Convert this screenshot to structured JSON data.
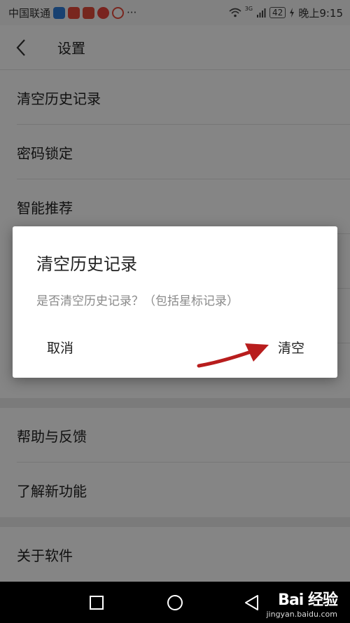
{
  "status_bar": {
    "carrier": "中国联通",
    "app_icon_colors": [
      "#2f7ed8",
      "#e84c3d",
      "#e84c3d",
      "#e8443c"
    ],
    "more": "···",
    "network": "3G",
    "battery": "42",
    "time": "晚上9:15"
  },
  "header": {
    "title": "设置"
  },
  "settings": {
    "group1": [
      "清空历史记录",
      "密码锁定",
      "智能推荐"
    ],
    "group2": [
      "帮助与反馈",
      "了解新功能"
    ],
    "group3": [
      "关于软件"
    ]
  },
  "dialog": {
    "title": "清空历史记录",
    "message": "是否清空历史记录？（包括星标记录）",
    "cancel_label": "取消",
    "confirm_label": "清空"
  },
  "watermark": {
    "brand": "Bai 经验",
    "url": "jingyan.baidu.com"
  },
  "colors": {
    "annotation_arrow": "#b81d1d"
  }
}
